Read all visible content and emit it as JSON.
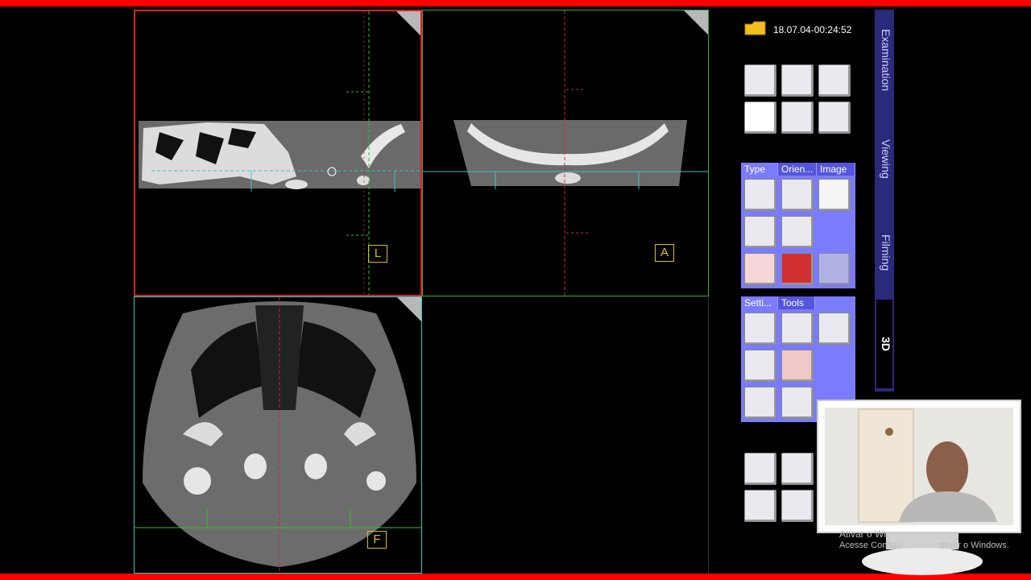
{
  "header": {
    "timestamp": "18.07.04-00:24:52"
  },
  "side_tabs": [
    {
      "label": "Examination"
    },
    {
      "label": "Viewing"
    },
    {
      "label": "Filming"
    },
    {
      "label": "3D"
    }
  ],
  "viewports": [
    {
      "orientation_label": "L"
    },
    {
      "orientation_label": "A"
    },
    {
      "orientation_label": "F"
    }
  ],
  "type_group": {
    "tabs": [
      "Type",
      "Orien...",
      "Image"
    ]
  },
  "settings_group": {
    "tabs": [
      "Setti...",
      "Tools"
    ]
  },
  "watermark": {
    "line1": "Ativar o Wi",
    "line2": "Acesse Configu",
    "line3": "ativar o Windows."
  },
  "colors": {
    "accent_red": "#ff0000",
    "panel_blue": "#2a2a7a",
    "group_blue": "#7b7bff",
    "orient_yellow": "#d8c400"
  }
}
